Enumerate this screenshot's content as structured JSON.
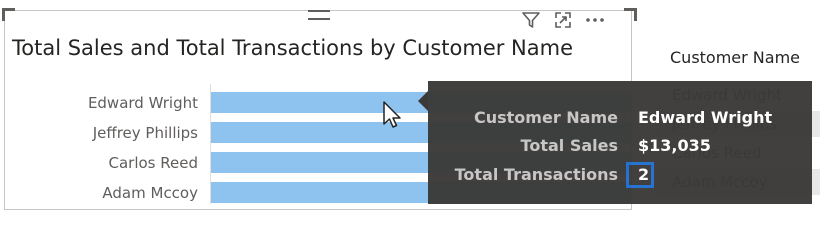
{
  "visual": {
    "title": "Total Sales and Total Transactions by Customer Name",
    "header_icons": [
      "filter-icon",
      "focus-mode-icon",
      "more-options-icon"
    ]
  },
  "chart_data": {
    "type": "bar",
    "title": "Total Sales and Total Transactions by Customer Name",
    "categories": [
      "Edward Wright",
      "Jeffrey Phillips",
      "Carlos Reed",
      "Adam Mccoy"
    ],
    "series": [
      {
        "values": [
          13035,
          null,
          null,
          null
        ]
      }
    ],
    "colors": [
      "#8ec3ef"
    ]
  },
  "tooltip": {
    "rows": [
      {
        "label": "Customer Name",
        "value": "Edward Wright"
      },
      {
        "label": "Total Sales",
        "value": "$13,035"
      },
      {
        "label": "Total Transactions",
        "value": "2"
      }
    ],
    "background": "#3b3a39",
    "highlight_color": "#1f6fd1"
  },
  "table": {
    "column_header": "Customer Name",
    "rows": [
      "Edward Wright",
      "Jeffrey Phillips",
      "Carlos Reed",
      "Adam Mccoy"
    ]
  }
}
